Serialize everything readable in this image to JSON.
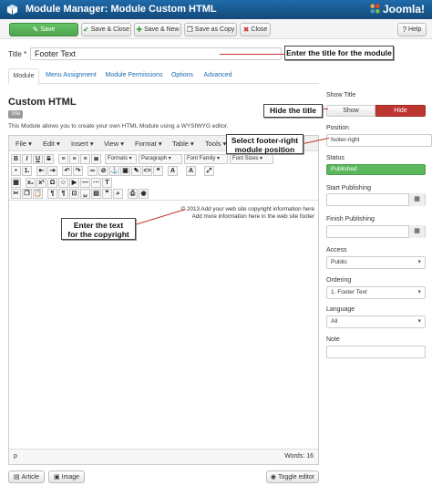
{
  "header": {
    "title": "Module Manager: Module Custom HTML",
    "logo_text": "Joomla!",
    "module_icon": "cube-icon"
  },
  "toolbar": {
    "save": "Save",
    "save_close": "Save & Close",
    "save_new": "Save & New",
    "save_copy": "Save as Copy",
    "close": "Close",
    "help": "Help"
  },
  "form": {
    "title_label": "Title *",
    "title_value": "Footer Text"
  },
  "callouts": {
    "title": "Enter the title for the module",
    "hide": "Hide the title",
    "position_line1": "Select footer-right",
    "position_line2": "module position",
    "copyright_line1": "Enter the text",
    "copyright_line2": "for the copyright"
  },
  "tabs": [
    "Module",
    "Menu Assignment",
    "Module Permissions",
    "Options",
    "Advanced"
  ],
  "module": {
    "heading": "Custom HTML",
    "badge": "Site",
    "description": "This Module allows you to create your own HTML Module using a WYSIWYG editor."
  },
  "editor": {
    "menus": [
      "File",
      "Edit",
      "Insert",
      "View",
      "Format",
      "Table",
      "Tools"
    ],
    "selects": {
      "formats": "Formats",
      "paragraph": "Paragraph",
      "font_family": "Font Family",
      "font_sizes": "Font Sizes"
    },
    "content_line1": "© 2013 Add your web site copyright information here",
    "content_line2": "Add more information here in the web site footer",
    "path": "p",
    "words": "Words: 16",
    "article_button": "Article",
    "image_button": "Image",
    "toggle_button": "Toggle editor"
  },
  "sidebar": {
    "show_title_label": "Show Title",
    "show": "Show",
    "hide": "Hide",
    "position_label": "Position",
    "position_value": "footer-right",
    "status_label": "Status",
    "status_value": "Published",
    "start_label": "Start Publishing",
    "finish_label": "Finish Publishing",
    "access_label": "Access",
    "access_value": "Public",
    "ordering_label": "Ordering",
    "ordering_value": "1. Footer Text",
    "language_label": "Language",
    "language_value": "All",
    "note_label": "Note"
  },
  "colors": {
    "header_bg": "#17568c",
    "save_green": "#51a351",
    "hide_red": "#bd362f",
    "published_green": "#5cb85c",
    "leader_red": "#c0392b"
  }
}
